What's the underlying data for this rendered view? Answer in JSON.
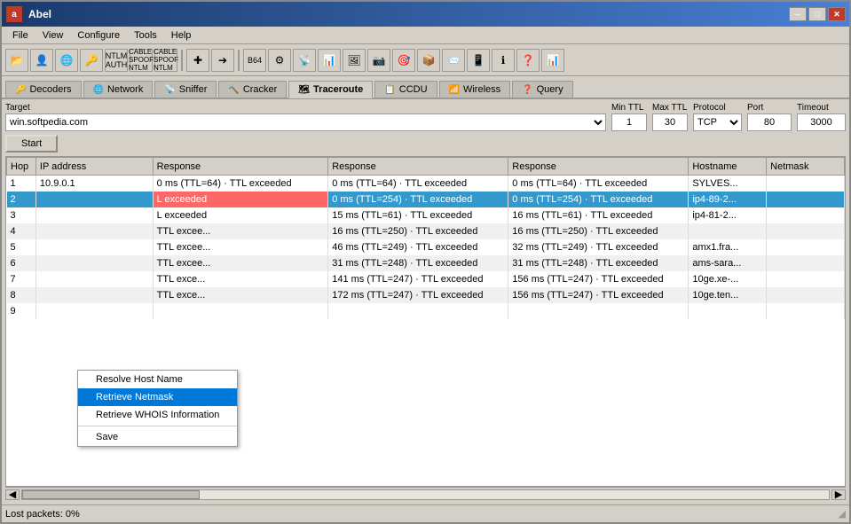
{
  "window": {
    "title": "Abel",
    "icon_text": "a",
    "min_btn": "─",
    "max_btn": "□",
    "close_btn": "✕"
  },
  "menu": {
    "items": [
      "File",
      "View",
      "Configure",
      "Tools",
      "Help"
    ]
  },
  "tabs": [
    {
      "label": "Decoders",
      "icon": "🔑",
      "active": false
    },
    {
      "label": "Network",
      "icon": "🌐",
      "active": false
    },
    {
      "label": "Sniffer",
      "icon": "📡",
      "active": false
    },
    {
      "label": "Cracker",
      "icon": "🔨",
      "active": false
    },
    {
      "label": "Traceroute",
      "icon": "🗺",
      "active": true
    },
    {
      "label": "CCDU",
      "icon": "📋",
      "active": false
    },
    {
      "label": "Wireless",
      "icon": "📶",
      "active": false
    },
    {
      "label": "Query",
      "icon": "❓",
      "active": false
    }
  ],
  "target_section": {
    "label": "Target",
    "input_value": "win.softpedia.com",
    "min_ttl_label": "Min TTL",
    "min_ttl_value": "1",
    "max_ttl_label": "Max TTL",
    "max_ttl_value": "30",
    "protocol_label": "Protocol",
    "protocol_value": "TCP",
    "port_label": "Port",
    "port_value": "80",
    "timeout_label": "Timeout",
    "timeout_value": "3000",
    "start_btn": "Start"
  },
  "table": {
    "headers": [
      "Hop",
      "IP address",
      "Response",
      "Response",
      "Response",
      "Hostname",
      "Netmask"
    ],
    "rows": [
      {
        "hop": "1",
        "ip": "10.9.0.1",
        "resp1": "0 ms (TTL=64) · TTL exceeded",
        "resp2": "0 ms (TTL=64) · TTL exceeded",
        "resp3": "0 ms (TTL=64) · TTL exceeded",
        "hostname": "SYLVES...",
        "netmask": "",
        "selected": false
      },
      {
        "hop": "2",
        "ip": "",
        "resp1": "L exceeded",
        "resp2": "0 ms (TTL=254) · TTL exceeded",
        "resp3": "0 ms (TTL=254) · TTL exceeded",
        "hostname": "ip4-89-2...",
        "netmask": "",
        "selected": true
      },
      {
        "hop": "3",
        "ip": "",
        "resp1": "L exceeded",
        "resp2": "15 ms (TTL=61) · TTL exceeded",
        "resp3": "16 ms (TTL=61) · TTL exceeded",
        "hostname": "ip4-81-2...",
        "netmask": "",
        "selected": false
      },
      {
        "hop": "4",
        "ip": "",
        "resp1": "TTL excee...",
        "resp2": "16 ms (TTL=250) · TTL exceeded",
        "resp3": "16 ms (TTL=250) · TTL exceeded",
        "hostname": "",
        "netmask": "",
        "selected": false
      },
      {
        "hop": "5",
        "ip": "",
        "resp1": "TTL excee...",
        "resp2": "46 ms (TTL=249) · TTL exceeded",
        "resp3": "32 ms (TTL=249) · TTL exceeded",
        "hostname": "amx1.fra...",
        "netmask": "",
        "selected": false
      },
      {
        "hop": "6",
        "ip": "",
        "resp1": "TTL excee...",
        "resp2": "31 ms (TTL=248) · TTL exceeded",
        "resp3": "31 ms (TTL=248) · TTL exceeded",
        "hostname": "ams-sara...",
        "netmask": "",
        "selected": false
      },
      {
        "hop": "7",
        "ip": "",
        "resp1": "TTL exce...",
        "resp2": "141 ms (TTL=247) · TTL exceeded",
        "resp3": "156 ms (TTL=247) · TTL exceeded",
        "hostname": "10ge.xe-...",
        "netmask": "",
        "selected": false
      },
      {
        "hop": "8",
        "ip": "",
        "resp1": "TTL exce...",
        "resp2": "172 ms (TTL=247) · TTL exceeded",
        "resp3": "156 ms (TTL=247) · TTL exceeded",
        "hostname": "10ge.ten...",
        "netmask": "",
        "selected": false
      },
      {
        "hop": "9",
        "ip": "",
        "resp1": "",
        "resp2": "",
        "resp3": "",
        "hostname": "",
        "netmask": "",
        "selected": false
      }
    ]
  },
  "context_menu": {
    "items": [
      {
        "label": "Resolve Host Name",
        "active": false
      },
      {
        "label": "Retrieve Netmask",
        "active": true
      },
      {
        "label": "Retrieve WHOIS Information",
        "active": false
      },
      {
        "separator": true
      },
      {
        "label": "Save",
        "active": false
      }
    ]
  },
  "status": {
    "lost_packets_label": "Lost packets:",
    "lost_packets_value": "0%"
  },
  "toolbar_icons": [
    "📂",
    "👤",
    "🌐",
    "🔑",
    "📊",
    "🔄",
    "✚",
    "➕",
    "➔",
    "📋",
    "B",
    "⚙",
    "📡",
    "📊",
    "🖼",
    "📷",
    "🎯",
    "📦",
    "📨",
    "📱",
    "🔍",
    "❓",
    "📶",
    "📊"
  ],
  "colors": {
    "selected_row_bg": "#3399cc",
    "selected_row_text": "#ffffff",
    "highlight_resp": "#3399cc"
  }
}
